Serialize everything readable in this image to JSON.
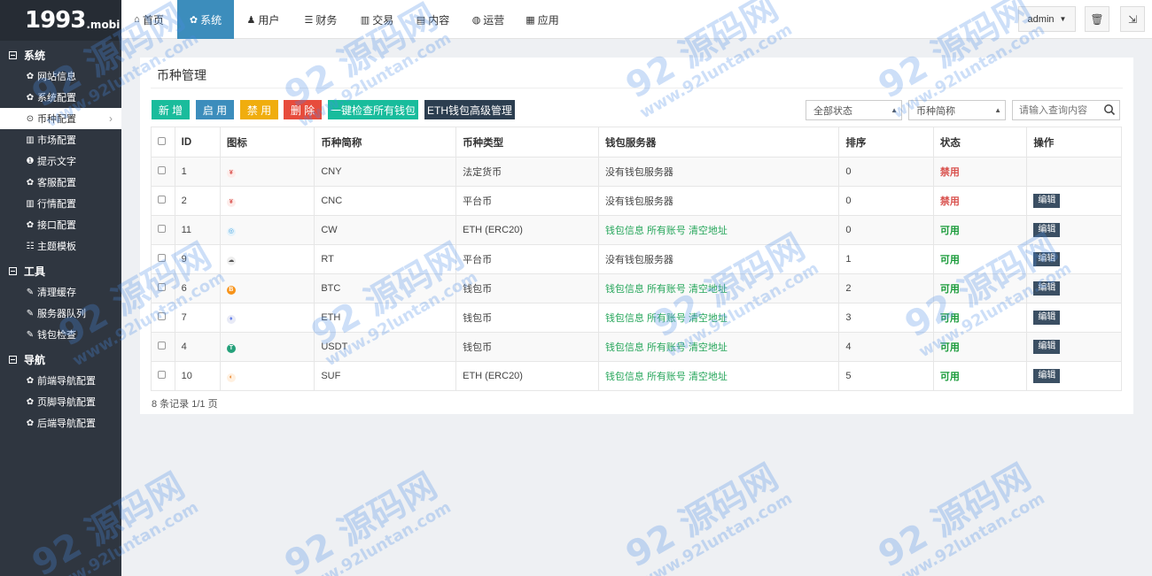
{
  "logo": {
    "big": "1993",
    "small": ".mobi"
  },
  "sidebar": {
    "groups": [
      {
        "label": "系统",
        "items": [
          {
            "label": "网站信息",
            "icon": "gear-icon",
            "glyph": "✿"
          },
          {
            "label": "系统配置",
            "icon": "gear-icon",
            "glyph": "✿"
          },
          {
            "label": "币种配置",
            "icon": "circle-dot-icon",
            "glyph": "⊙"
          },
          {
            "label": "市场配置",
            "icon": "bar-chart-icon",
            "glyph": "▥"
          },
          {
            "label": "提示文字",
            "icon": "info-icon",
            "glyph": "❶"
          },
          {
            "label": "客服配置",
            "icon": "gear-icon",
            "glyph": "✿"
          },
          {
            "label": "行情配置",
            "icon": "bar-chart-icon",
            "glyph": "▥"
          },
          {
            "label": "接口配置",
            "icon": "gear-icon",
            "glyph": "✿"
          },
          {
            "label": "主题模板",
            "icon": "list-icon",
            "glyph": "☷"
          }
        ]
      },
      {
        "label": "工具",
        "items": [
          {
            "label": "清理缓存",
            "icon": "wrench-icon",
            "glyph": "✎"
          },
          {
            "label": "服务器队列",
            "icon": "wrench-icon",
            "glyph": "✎"
          },
          {
            "label": "钱包检查",
            "icon": "wrench-icon",
            "glyph": "✎"
          }
        ]
      },
      {
        "label": "导航",
        "items": [
          {
            "label": "前端导航配置",
            "icon": "gear-icon",
            "glyph": "✿"
          },
          {
            "label": "页脚导航配置",
            "icon": "gear-icon",
            "glyph": "✿"
          },
          {
            "label": "后端导航配置",
            "icon": "gear-icon",
            "glyph": "✿"
          }
        ]
      }
    ]
  },
  "nav": {
    "tabs": [
      {
        "label": "首页",
        "icon": "home-icon",
        "glyph": "⌂"
      },
      {
        "label": "系统",
        "icon": "gear-icon",
        "glyph": "✿"
      },
      {
        "label": "用户",
        "icon": "user-icon",
        "glyph": "♟"
      },
      {
        "label": "财务",
        "icon": "list-icon",
        "glyph": "☰"
      },
      {
        "label": "交易",
        "icon": "bar-chart-icon",
        "glyph": "▥"
      },
      {
        "label": "内容",
        "icon": "document-icon",
        "glyph": "▤"
      },
      {
        "label": "运营",
        "icon": "globe-icon",
        "glyph": "◍"
      },
      {
        "label": "应用",
        "icon": "grid-icon",
        "glyph": "▦"
      }
    ],
    "admin_label": "admin",
    "trash_glyph": "🗑",
    "logout_glyph": "⇲"
  },
  "page": {
    "title": "币种管理",
    "buttons": {
      "add": "新 增",
      "enable": "启 用",
      "disable": "禁 用",
      "delete": "删 除",
      "check_wallets": "一键检查所有钱包",
      "eth_manage": "ETH钱包高级管理"
    },
    "filters": {
      "status": "全部状态",
      "field": "币种简称",
      "search_placeholder": "请输入查询内容"
    },
    "colors": {
      "add": "#1abc9c",
      "enable": "#3c8dbc",
      "disable": "#f0ad0e",
      "delete": "#e74c3c",
      "check_wallets": "#18bc9c",
      "eth_manage": "#2c3e50"
    },
    "footer": "8 条记录 1/1 页"
  },
  "table": {
    "headers": [
      "ID",
      "图标",
      "币种简称",
      "币种类型",
      "钱包服务器",
      "排序",
      "状态",
      "操作"
    ],
    "wallet_link_labels": [
      "钱包信息",
      "所有账号",
      "清空地址"
    ],
    "no_server_label": "没有钱包服务器",
    "edit_label": "编辑",
    "rows": [
      {
        "id": "1",
        "icon_color": "#fdecea",
        "icon_fg": "#d9534f",
        "icon_glyph": "¥",
        "code": "CNY",
        "type": "法定货币",
        "server": "none",
        "sort": "0",
        "status": "禁用",
        "status_class": "st-off",
        "edit": false
      },
      {
        "id": "2",
        "icon_color": "#fdecea",
        "icon_fg": "#d9534f",
        "icon_glyph": "¥",
        "code": "CNC",
        "type": "平台币",
        "server": "none",
        "sort": "0",
        "status": "禁用",
        "status_class": "st-off",
        "edit": true
      },
      {
        "id": "11",
        "icon_color": "#e5f3fb",
        "icon_fg": "#4aa3df",
        "icon_glyph": "◎",
        "code": "CW",
        "type": "ETH (ERC20)",
        "server": "links",
        "sort": "0",
        "status": "可用",
        "status_class": "st-on",
        "edit": true
      },
      {
        "id": "9",
        "icon_color": "#eeeeee",
        "icon_fg": "#555555",
        "icon_glyph": "☁",
        "code": "RT",
        "type": "平台币",
        "server": "none",
        "sort": "1",
        "status": "可用",
        "status_class": "st-on",
        "edit": true
      },
      {
        "id": "6",
        "icon_color": "#f7931a",
        "icon_fg": "#ffffff",
        "icon_glyph": "B",
        "code": "BTC",
        "type": "钱包币",
        "server": "links",
        "sort": "2",
        "status": "可用",
        "status_class": "st-on",
        "edit": true
      },
      {
        "id": "7",
        "icon_color": "#e8eaf6",
        "icon_fg": "#627eea",
        "icon_glyph": "♦",
        "code": "ETH",
        "type": "钱包币",
        "server": "links",
        "sort": "3",
        "status": "可用",
        "status_class": "st-on",
        "edit": true
      },
      {
        "id": "4",
        "icon_color": "#26a17b",
        "icon_fg": "#ffffff",
        "icon_glyph": "T",
        "code": "USDT",
        "type": "钱包币",
        "server": "links",
        "sort": "4",
        "status": "可用",
        "status_class": "st-on",
        "edit": true
      },
      {
        "id": "10",
        "icon_color": "#fff0e0",
        "icon_fg": "#e67e22",
        "icon_glyph": "◐",
        "code": "SUF",
        "type": "ETH (ERC20)",
        "server": "links",
        "sort": "5",
        "status": "可用",
        "status_class": "st-on",
        "edit": true
      }
    ]
  },
  "watermark": {
    "line1": "92 源码网",
    "line2": "www.92luntan.com"
  }
}
